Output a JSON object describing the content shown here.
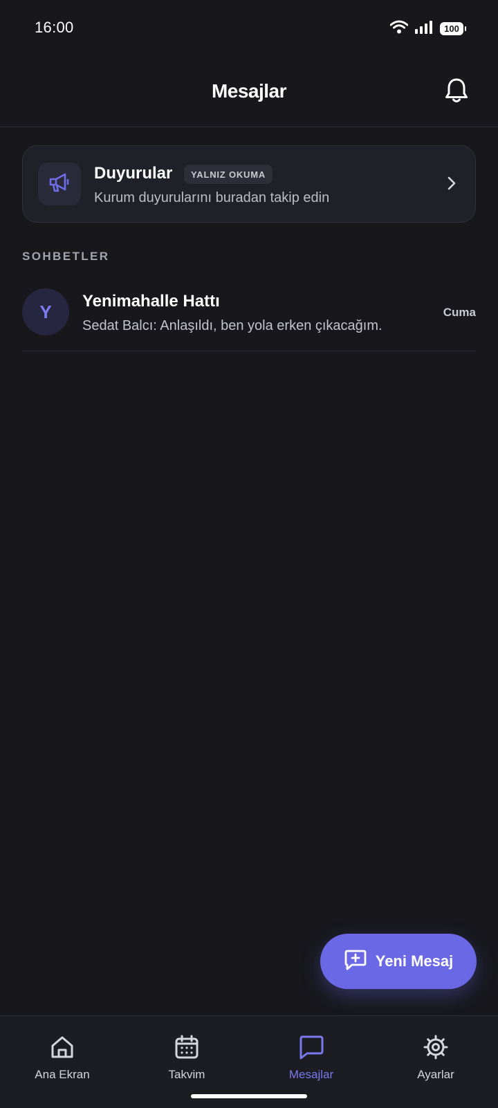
{
  "status_bar": {
    "time": "16:00",
    "battery": "100"
  },
  "header": {
    "title": "Mesajlar"
  },
  "announcement": {
    "title": "Duyurular",
    "badge": "YALNIZ OKUMA",
    "subtitle": "Kurum duyurularını buradan takip edin"
  },
  "section": {
    "label": "SOHBETLER"
  },
  "chats": [
    {
      "avatar_letter": "Y",
      "name": "Yenimahalle Hattı",
      "preview": "Sedat Balcı: Anlaşıldı, ben yola erken çıkacağım.",
      "time": "Cuma"
    }
  ],
  "fab": {
    "label": "Yeni Mesaj"
  },
  "nav": {
    "items": [
      {
        "label": "Ana Ekran",
        "icon": "home-icon"
      },
      {
        "label": "Takvim",
        "icon": "calendar-icon"
      },
      {
        "label": "Mesajlar",
        "icon": "message-icon"
      },
      {
        "label": "Ayarlar",
        "icon": "gear-icon"
      }
    ],
    "active_index": 2
  },
  "colors": {
    "background": "#17171c",
    "accent": "#6b68e6",
    "card": "#1f2028",
    "nav_background": "#1c1d23"
  }
}
